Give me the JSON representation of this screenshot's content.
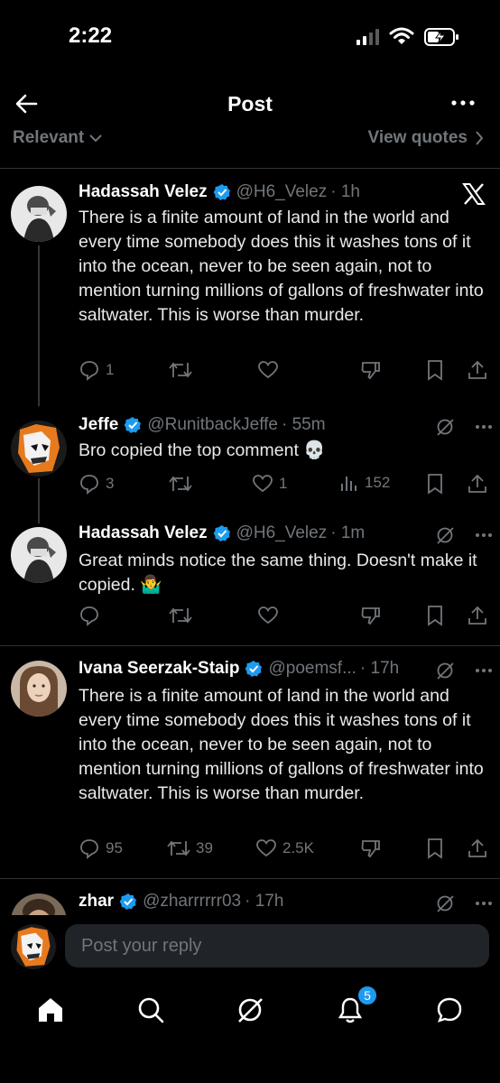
{
  "status_bar": {
    "time": "2:22"
  },
  "header": {
    "title": "Post",
    "sort_label": "Relevant",
    "quotes_label": "View quotes"
  },
  "posts": [
    {
      "name": "Hadassah Velez",
      "handle": "@H6_Velez",
      "time": "· 1h",
      "text": "There is a finite amount of land in the world and every time somebody does this it washes tons of it into the ocean, never to be seen again, not to mention turning millions of gallons of freshwater into saltwater.  This is worse than murder.",
      "replies": "1",
      "reposts": "",
      "likes": ""
    },
    {
      "name": "Jeffe",
      "handle": "@RunitbackJeffe",
      "time": "· 55m",
      "text": "Bro copied the top comment 💀",
      "replies": "3",
      "reposts": "",
      "likes": "1",
      "views": "152"
    },
    {
      "name": "Hadassah Velez",
      "handle": "@H6_Velez",
      "time": "· 1m",
      "text": "Great minds notice the same thing. Doesn't make it copied. 🤷‍♂️",
      "replies": "",
      "reposts": "",
      "likes": ""
    },
    {
      "name": "Ivana Seerzak-Staip",
      "handle": "@poemsf...",
      "time": "· 17h",
      "text": "There is a finite amount of land in the world and every time somebody does this it washes tons of it into the ocean, never to be seen again, not to mention turning millions of gallons of freshwater into saltwater.  This is worse than murder.",
      "replies": "95",
      "reposts": "39",
      "likes": "2.5K"
    },
    {
      "name": "zhar",
      "handle": "@zharrrrrr03",
      "time": "· 17h"
    }
  ],
  "reply_bar": {
    "placeholder": "Post your reply"
  },
  "tabbar": {
    "notifications_count": "5"
  },
  "colors": {
    "background": "#000000",
    "muted": "#71767b",
    "accent": "#1d9bf0",
    "divider": "#2f3336"
  }
}
